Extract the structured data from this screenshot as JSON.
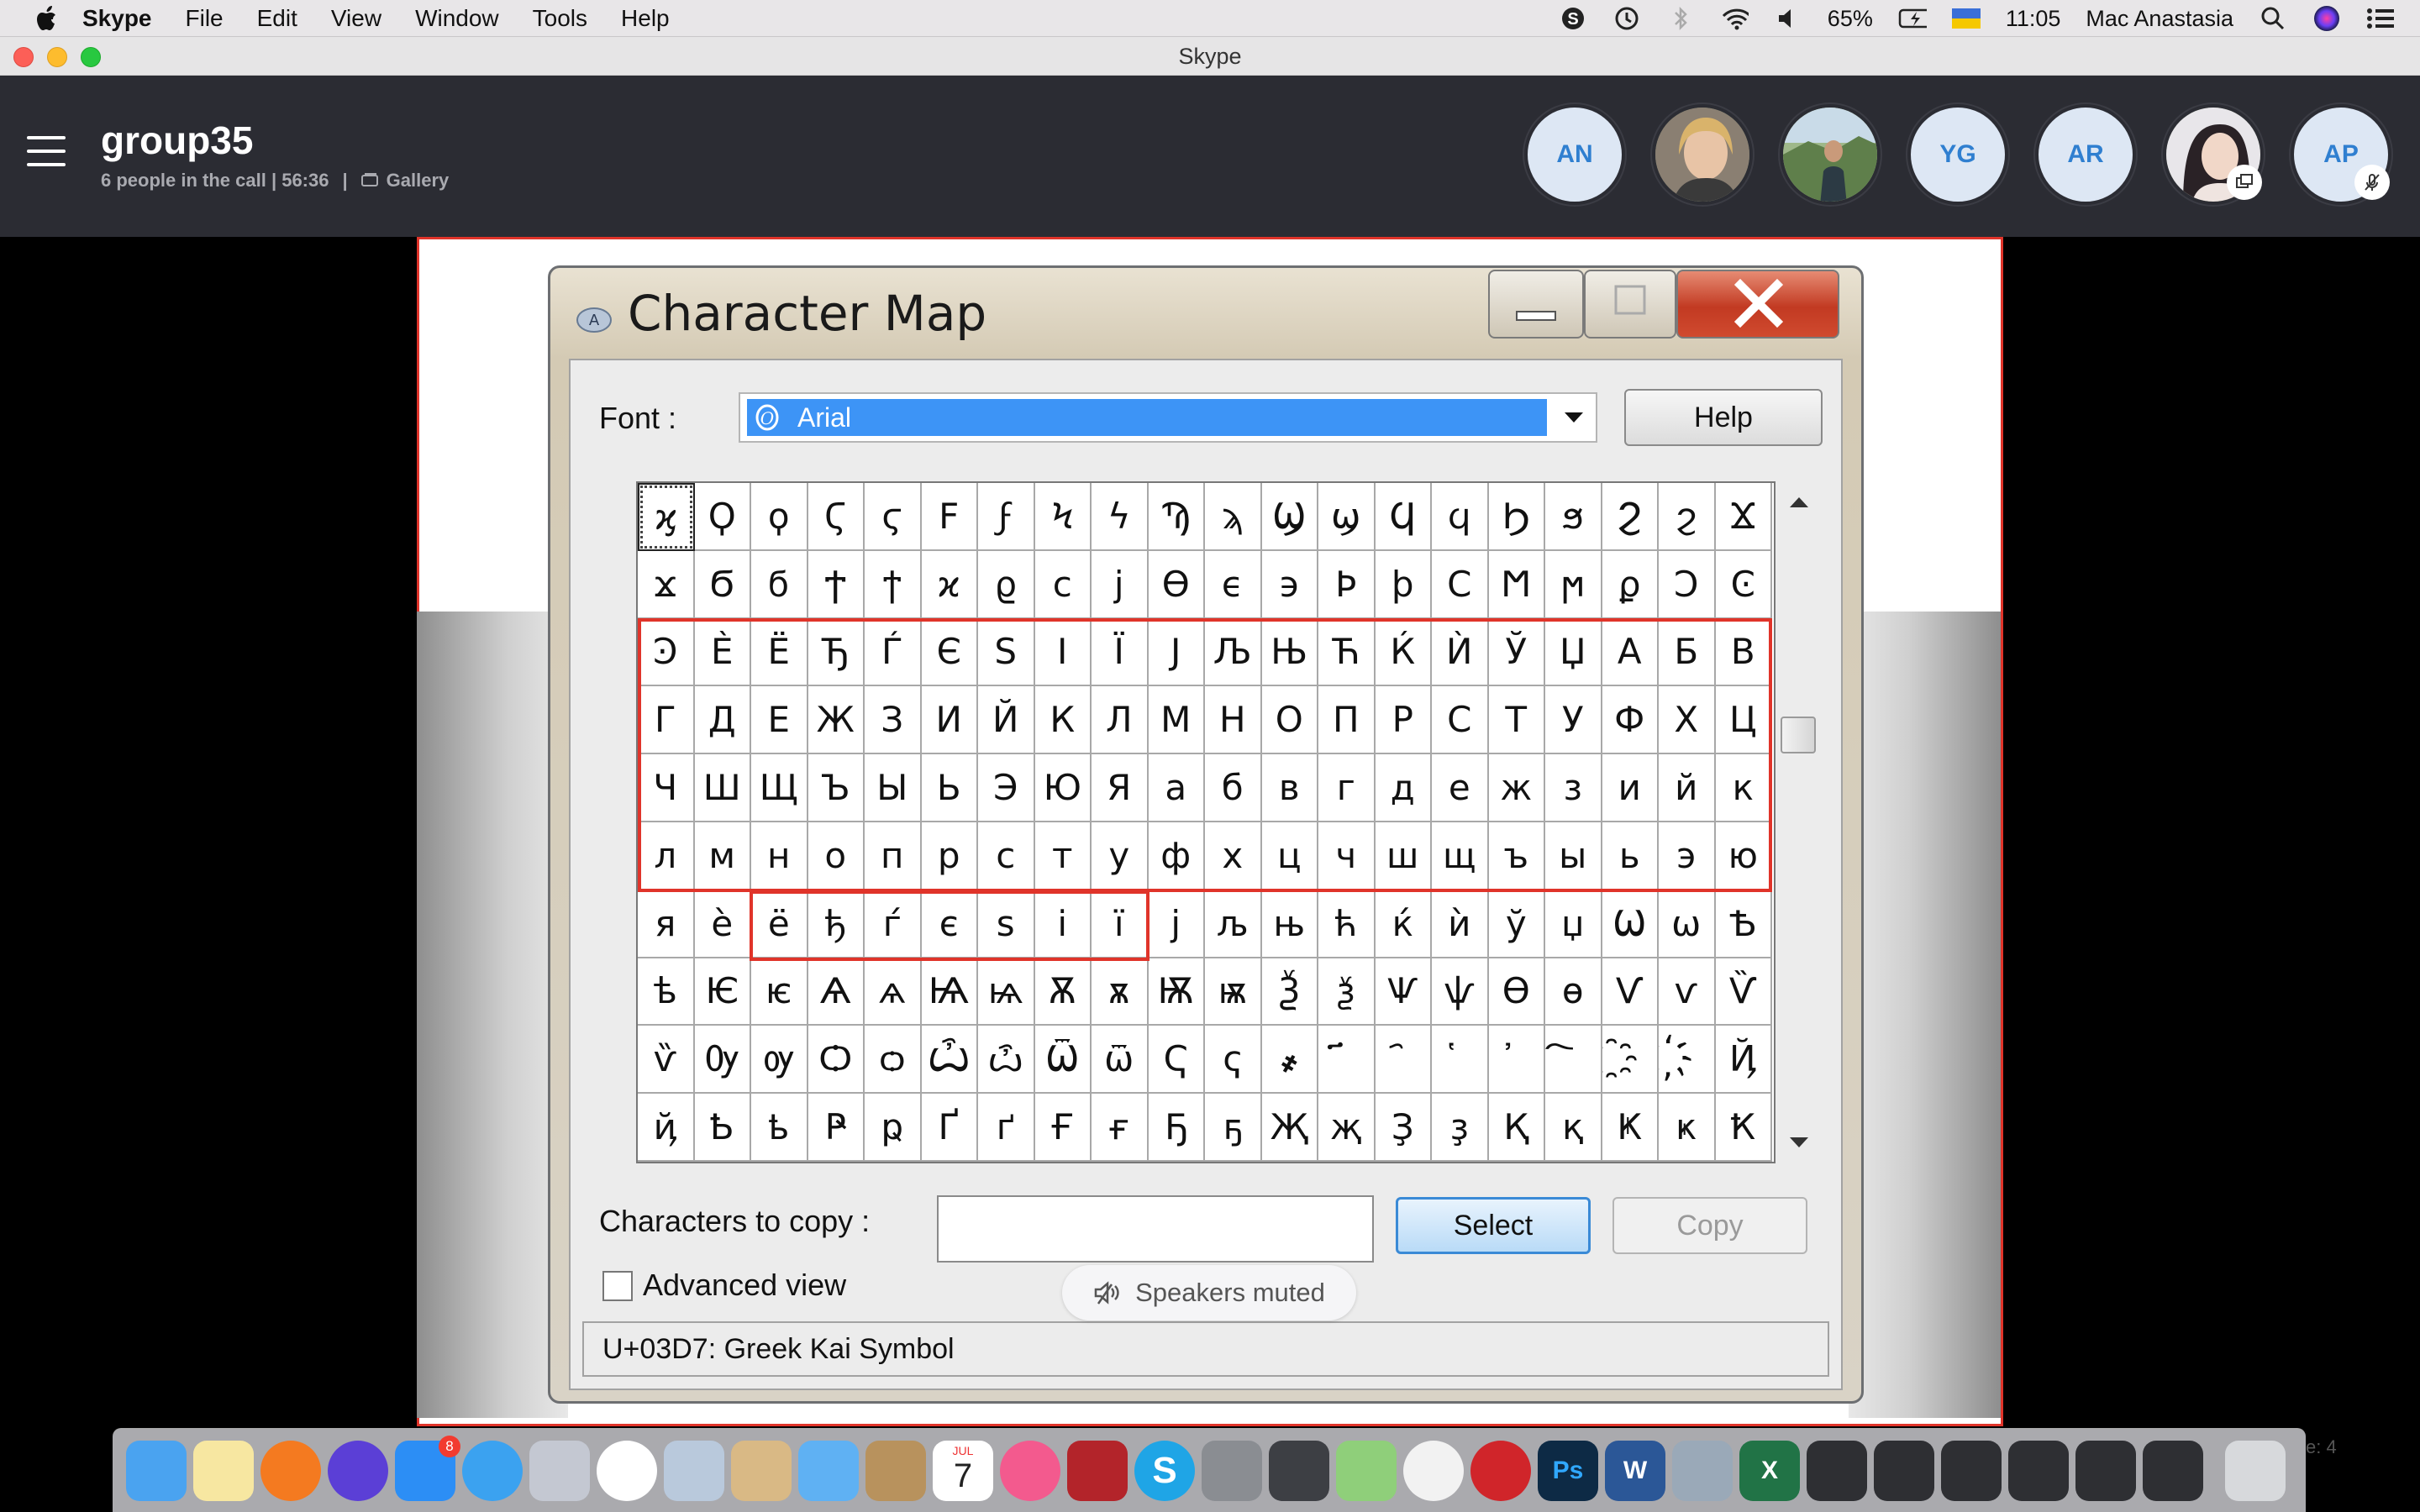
{
  "menubar": {
    "app": "Skype",
    "items": [
      "File",
      "Edit",
      "View",
      "Window",
      "Tools",
      "Help"
    ],
    "battery": "65%",
    "time": "11:05",
    "user": "Mac Anastasia"
  },
  "window": {
    "title": "Skype"
  },
  "call": {
    "group_name": "group35",
    "status": "6 people in the call | 56:36",
    "separator": "|",
    "view_label": "Gallery",
    "participants": [
      {
        "initials": "AN"
      },
      {
        "initials": ""
      },
      {
        "initials": ""
      },
      {
        "initials": "YG"
      },
      {
        "initials": "AR"
      },
      {
        "initials": ""
      },
      {
        "initials": "AP"
      }
    ]
  },
  "charmap": {
    "title": "Character Map",
    "font_label": "Font :",
    "font_value": "Arial",
    "help_label": "Help",
    "rows": [
      [
        "ϗ",
        "Ϙ",
        "ϙ",
        "Ϛ",
        "ϛ",
        "Ϝ",
        "ϝ",
        "Ϟ",
        "ϟ",
        "Ϡ",
        "ϡ",
        "Ϣ",
        "ϣ",
        "Ϥ",
        "ϥ",
        "Ϧ",
        "ϧ",
        "Ϩ",
        "ϩ",
        "Ϫ"
      ],
      [
        "ϫ",
        "Ϭ",
        "ϭ",
        "Ϯ",
        "ϯ",
        "ϰ",
        "ϱ",
        "ϲ",
        "ϳ",
        "ϴ",
        "ϵ",
        "϶",
        "Ϸ",
        "ϸ",
        "Ϲ",
        "Ϻ",
        "ϻ",
        "ϼ",
        "Ͻ",
        "Ͼ"
      ],
      [
        "Ͽ",
        "Ѐ",
        "Ё",
        "Ђ",
        "Ѓ",
        "Є",
        "Ѕ",
        "І",
        "Ї",
        "Ј",
        "Љ",
        "Њ",
        "Ћ",
        "Ќ",
        "Ѝ",
        "Ў",
        "Џ",
        "А",
        "Б",
        "В"
      ],
      [
        "Г",
        "Д",
        "Е",
        "Ж",
        "З",
        "И",
        "Й",
        "К",
        "Л",
        "М",
        "Н",
        "О",
        "П",
        "Р",
        "С",
        "Т",
        "У",
        "Ф",
        "Х",
        "Ц"
      ],
      [
        "Ч",
        "Ш",
        "Щ",
        "Ъ",
        "Ы",
        "Ь",
        "Э",
        "Ю",
        "Я",
        "а",
        "б",
        "в",
        "г",
        "д",
        "е",
        "ж",
        "з",
        "и",
        "й",
        "к"
      ],
      [
        "л",
        "м",
        "н",
        "о",
        "п",
        "р",
        "с",
        "т",
        "у",
        "ф",
        "х",
        "ц",
        "ч",
        "ш",
        "щ",
        "ъ",
        "ы",
        "ь",
        "э",
        "ю"
      ],
      [
        "я",
        "ѐ",
        "ё",
        "ђ",
        "ѓ",
        "є",
        "ѕ",
        "і",
        "ї",
        "ј",
        "љ",
        "њ",
        "ћ",
        "ќ",
        "ѝ",
        "ў",
        "џ",
        "Ѡ",
        "ѡ",
        "Ѣ"
      ],
      [
        "ѣ",
        "Ѥ",
        "ѥ",
        "Ѧ",
        "ѧ",
        "Ѩ",
        "ѩ",
        "Ѫ",
        "ѫ",
        "Ѭ",
        "ѭ",
        "Ѯ",
        "ѯ",
        "Ѱ",
        "ѱ",
        "Ѳ",
        "ѳ",
        "Ѵ",
        "ѵ",
        "Ѷ"
      ],
      [
        "ѷ",
        "Ѹ",
        "ѹ",
        "Ѻ",
        "ѻ",
        "Ѽ",
        "ѽ",
        "Ѿ",
        "ѿ",
        "Ҁ",
        "ҁ",
        "҂",
        "҃",
        "҄",
        "҅",
        "҆",
        "҇",
        "҈",
        "҉",
        "Ҋ"
      ],
      [
        "ҋ",
        "Ҍ",
        "ҍ",
        "Ҏ",
        "ҏ",
        "Ґ",
        "ґ",
        "Ғ",
        "ғ",
        "Ҕ",
        "ҕ",
        "Җ",
        "җ",
        "Ҙ",
        "ҙ",
        "Қ",
        "қ",
        "Ҝ",
        "ҝ",
        "Ҟ"
      ]
    ],
    "copy_label": "Characters to copy :",
    "copy_value": "",
    "select_label": "Select",
    "copy_button": "Copy",
    "advanced_label": "Advanced view",
    "status": "U+03D7: Greek Kai Symbol"
  },
  "overlay": {
    "speakers_muted": "Speakers muted"
  },
  "dock": {
    "icons": [
      "finder-icon",
      "notes-icon",
      "firefox-icon",
      "siri-icon",
      "app-store-icon",
      "safari-icon",
      "launchpad-icon",
      "chrome-icon",
      "preview-icon",
      "files-icon",
      "mail-icon",
      "contacts-icon",
      "calendar-icon",
      "itunes-icon",
      "photo-booth-icon",
      "skype-icon",
      "system-preferences-icon",
      "sublime-icon",
      "maps-icon",
      "photos-icon",
      "creative-cloud-icon",
      "photoshop-icon",
      "word-icon",
      "image-capture-icon",
      "excel-icon",
      "window-thumb-icon",
      "window-thumb-icon",
      "window-thumb-icon",
      "window-thumb-icon",
      "window-thumb-icon",
      "window-thumb-icon",
      "trash-icon"
    ],
    "appstore_badge": "8",
    "calendar_month": "JUL",
    "calendar_day": "7",
    "peek_text": "e: 4"
  }
}
